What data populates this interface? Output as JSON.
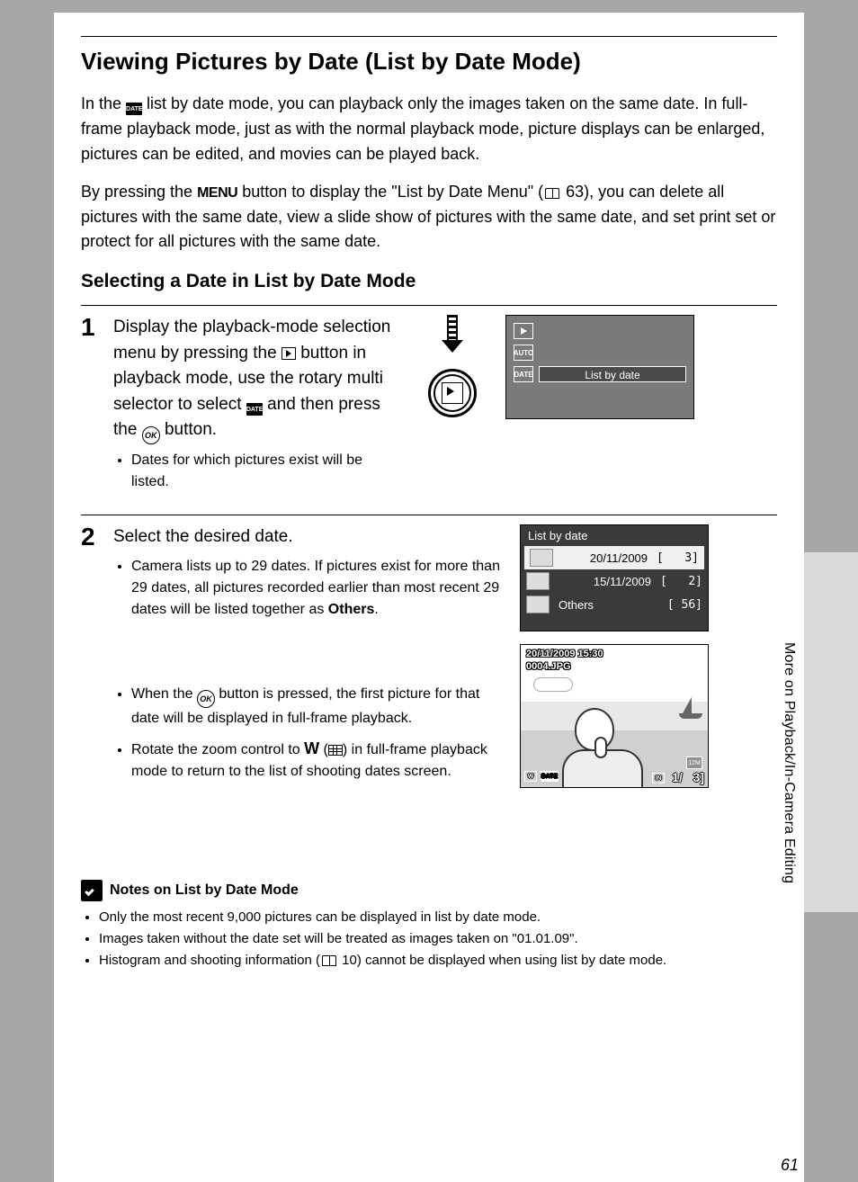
{
  "side_tab": "More on Playback/In-Camera Editing",
  "page_number": "61",
  "heading": "Viewing Pictures by Date (List by Date Mode)",
  "intro_p1_a": "In the ",
  "intro_p1_b": " list by date mode, you can playback only the images taken on the same date. In full-frame playback mode, just as with the normal playback mode, picture displays can be enlarged, pictures can be edited, and movies can be played back.",
  "intro_p2_a": "By pressing the ",
  "intro_menu_label": "MENU",
  "intro_p2_b": " button to display the \"List by Date Menu\" (",
  "intro_ref": " 63), you can delete all pictures with the same date, view a slide show of pictures with the same date, and set print set or protect for all pictures with the same date.",
  "sub_heading": "Selecting a Date in List by Date Mode",
  "step1": {
    "num": "1",
    "a": "Display the playback-mode selection menu by pressing the ",
    "b": " button in playback mode, use the rotary multi selector to select ",
    "c": " and then press the ",
    "d": " button.",
    "sub": "Dates for which pictures exist will be listed."
  },
  "screen1": {
    "title": "List by date",
    "auto": "AUTO",
    "date": "DATE"
  },
  "step2": {
    "num": "2",
    "inst": "Select the desired date.",
    "sub1_a": "Camera lists up to 29 dates. If pictures exist for more than 29 dates, all pictures recorded earlier than most recent 29 dates will be listed together as ",
    "sub1_b": "Others",
    "sub1_c": ".",
    "sub2_a": "When the ",
    "sub2_b": " button is pressed, the first picture for that date will be displayed in full-frame playback.",
    "sub3_a": "Rotate the zoom control to ",
    "sub3_w": "W",
    "sub3_b": " (",
    "sub3_c": ") in full-frame playback mode to return to the list of shooting dates screen."
  },
  "screen_list": {
    "title": "List by date",
    "rows": [
      {
        "date": "20/11/2009",
        "count": "3"
      },
      {
        "date": "15/11/2009",
        "count": "2"
      },
      {
        "date": "Others",
        "count": "56"
      }
    ]
  },
  "screen_play": {
    "timestamp": "20/11/2009 15:30",
    "filename": "0004.JPG",
    "size_mode": "12M",
    "counter_a": "1/",
    "counter_b": "3",
    "w_label": "W",
    "date_label": "DATE",
    "in_label": "IN"
  },
  "notes": {
    "title": "Notes on List by Date Mode",
    "items": [
      "Only the most recent 9,000 pictures can be displayed in list by date mode.",
      "Images taken without the date set will be treated as images taken on \"01.01.09\".",
      "Histogram and shooting information "
    ],
    "item3_ref": " 10) cannot be displayed when using list by date mode."
  }
}
